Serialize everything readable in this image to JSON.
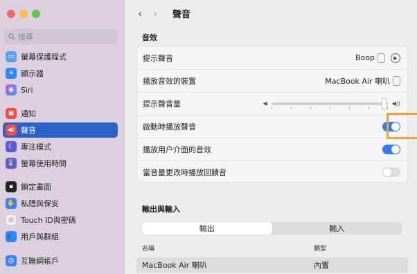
{
  "sidebar": {
    "search_placeholder": "搜尋",
    "items": [
      {
        "label": "螢幕保護程式",
        "icon": "screensaver-icon",
        "color": "#5aa3e6"
      },
      {
        "label": "顯示器",
        "icon": "display-icon",
        "color": "#2f86f6"
      },
      {
        "label": "Siri",
        "icon": "siri-icon",
        "color": "#2b2b3a"
      },
      {
        "label": "通知",
        "icon": "bell-icon",
        "color": "#ef4b46"
      },
      {
        "label": "聲音",
        "icon": "speaker-icon",
        "color": "#ef4b46"
      },
      {
        "label": "專注模式",
        "icon": "moon-icon",
        "color": "#5b5bd6"
      },
      {
        "label": "螢幕使用時間",
        "icon": "hourglass-icon",
        "color": "#5b5bd6"
      },
      {
        "label": "鎖定畫面",
        "icon": "lock-icon",
        "color": "#222222"
      },
      {
        "label": "私隱與保安",
        "icon": "hand-icon",
        "color": "#3a82f6"
      },
      {
        "label": "Touch ID與密碼",
        "icon": "fingerprint-icon",
        "color": "#f2f2f2"
      },
      {
        "label": "用戶與群組",
        "icon": "users-icon",
        "color": "#3a82f6"
      },
      {
        "label": "互聯網帳戶",
        "icon": "at-icon",
        "color": "#3a82f6"
      }
    ]
  },
  "header": {
    "title": "聲音"
  },
  "sound_effects": {
    "section_title": "音效",
    "alert_sound_label": "提示聲音",
    "alert_sound_value": "Boop",
    "output_device_label": "播放音效的裝置",
    "output_device_value": "MacBook Air 喇叭",
    "alert_volume_label": "提示聲音量",
    "alert_volume_level": 0.97,
    "startup_sound_label": "啟動時播放聲音",
    "startup_sound_on": true,
    "ui_sound_label": "播放用户介面的音效",
    "ui_sound_on": true,
    "volume_feedback_label": "當音量更改時播放回饋音",
    "volume_feedback_on": false
  },
  "output_input": {
    "section_title": "輸出與輸入",
    "tabs": [
      "輸出",
      "輸入"
    ],
    "selected_tab": "輸出",
    "col_name": "名稱",
    "col_type": "類型",
    "rows": [
      {
        "name": "MacBook Air 喇叭",
        "type": "內置"
      }
    ]
  },
  "colors": {
    "accent": "#2f7bf6",
    "sidebar_selected": "#2b62c7",
    "highlight": "#f1a23a"
  }
}
